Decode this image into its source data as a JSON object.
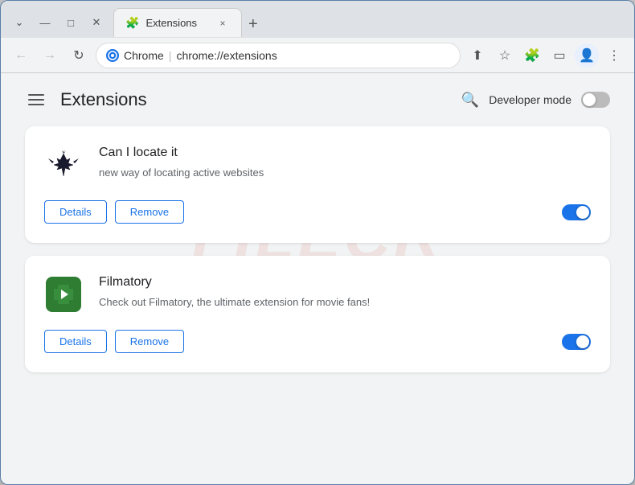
{
  "window": {
    "title": "Extensions",
    "favicon": "🧩"
  },
  "tab": {
    "label": "Extensions",
    "close_label": "×"
  },
  "new_tab_label": "+",
  "window_controls": {
    "minimize": "—",
    "maximize": "□",
    "close": "✕",
    "chevron": "⌄"
  },
  "omnibar": {
    "back_label": "←",
    "forward_label": "→",
    "refresh_label": "↻",
    "brand": "Chrome",
    "url": "chrome://extensions",
    "share_label": "⬆",
    "bookmark_label": "☆",
    "extensions_label": "🧩",
    "sidebar_label": "▭",
    "profile_label": "👤",
    "menu_label": "⋮"
  },
  "page": {
    "title": "Extensions",
    "search_label": "🔍",
    "developer_mode_label": "Developer mode",
    "developer_mode_on": false
  },
  "extensions": [
    {
      "id": "can-i-locate-it",
      "name": "Can I locate it",
      "description": "new way of locating active websites",
      "enabled": true,
      "details_label": "Details",
      "remove_label": "Remove"
    },
    {
      "id": "filmatory",
      "name": "Filmatory",
      "description": "Check out Filmatory, the ultimate extension for movie fans!",
      "enabled": true,
      "details_label": "Details",
      "remove_label": "Remove"
    }
  ],
  "watermark_text": "FILECR",
  "colors": {
    "accent": "#1a73e8",
    "toggle_on": "#1a73e8",
    "toggle_off": "#bbb"
  }
}
